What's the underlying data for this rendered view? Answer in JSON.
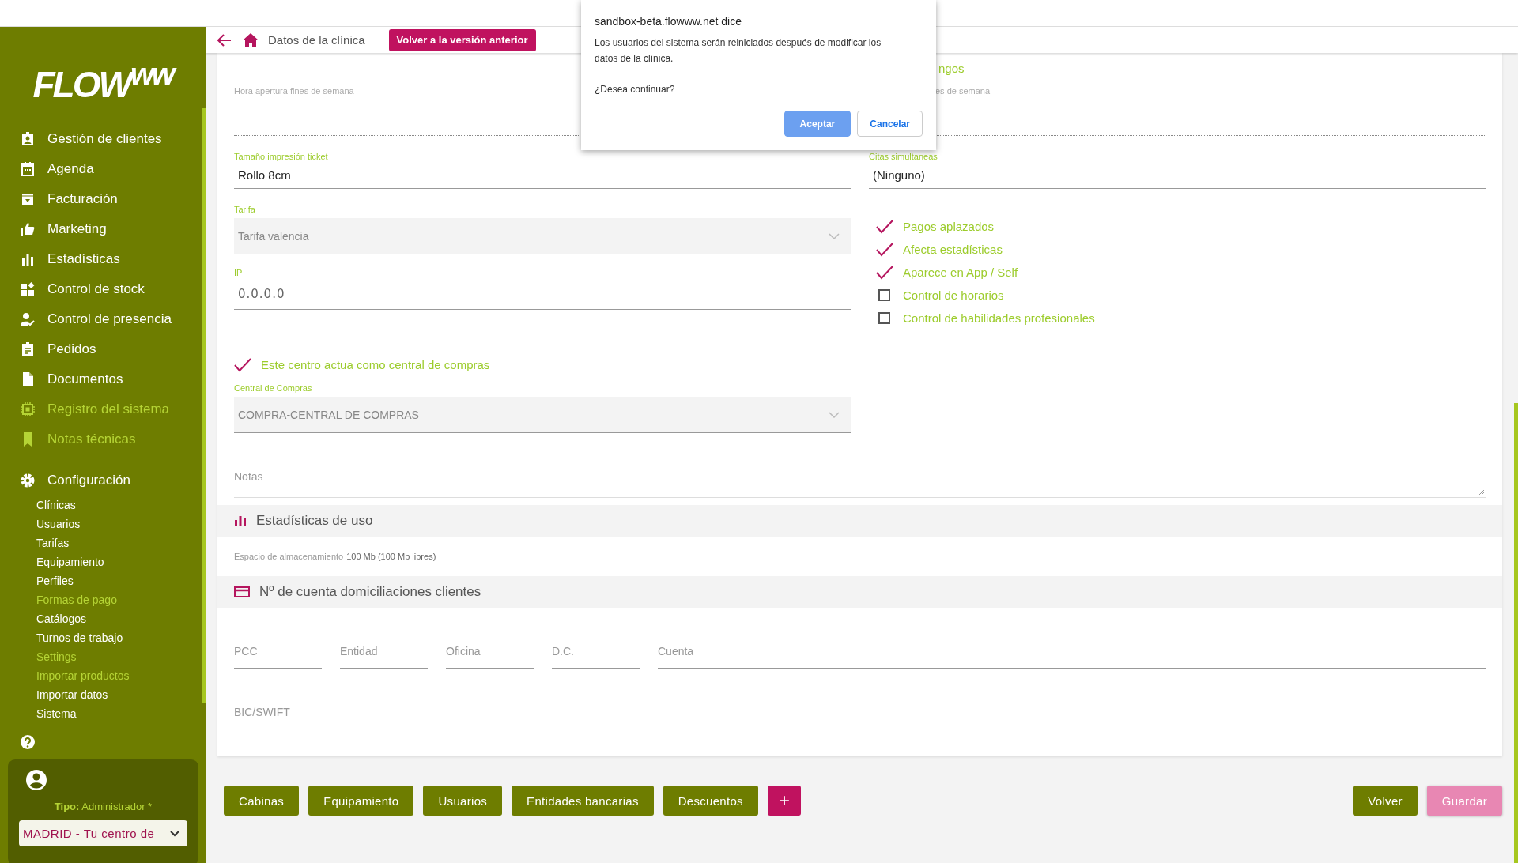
{
  "sidebar": {
    "logo": "FLOW$^{ww}$",
    "nav": [
      {
        "label": "Gestión de clientes",
        "highlighted": false
      },
      {
        "label": "Agenda",
        "highlighted": false
      },
      {
        "label": "Facturación",
        "highlighted": false
      },
      {
        "label": "Marketing",
        "highlighted": false
      },
      {
        "label": "Estadísticas",
        "highlighted": false
      },
      {
        "label": "Control de stock",
        "highlighted": false
      },
      {
        "label": "Control de presencia",
        "highlighted": false
      },
      {
        "label": "Pedidos",
        "highlighted": false
      },
      {
        "label": "Documentos",
        "highlighted": false
      },
      {
        "label": "Registro del sistema",
        "highlighted": true
      },
      {
        "label": "Notas técnicas",
        "highlighted": true
      }
    ],
    "config": {
      "label": "Configuración",
      "items": [
        {
          "label": "Clínicas",
          "highlighted": false
        },
        {
          "label": "Usuarios",
          "highlighted": false
        },
        {
          "label": "Tarifas",
          "highlighted": false
        },
        {
          "label": "Equipamiento",
          "highlighted": false
        },
        {
          "label": "Perfiles",
          "highlighted": false
        },
        {
          "label": "Formas de pago",
          "highlighted": true
        },
        {
          "label": "Catálogos",
          "highlighted": false
        },
        {
          "label": "Turnos de trabajo",
          "highlighted": false
        },
        {
          "label": "Settings",
          "highlighted": true
        },
        {
          "label": "Importar productos",
          "highlighted": true
        },
        {
          "label": "Importar datos",
          "highlighted": false
        },
        {
          "label": "Sistema",
          "highlighted": false
        }
      ]
    },
    "user": {
      "role": "**Tipo:** Administrador *",
      "center": "MADRID - Tu centro de"
    }
  },
  "header": {
    "title": "Datos de la clínica",
    "legacy_button": "Volver a la versión anterior"
  },
  "form": {
    "top_right_option": "ngos",
    "row1": [
      {
        "label": "Hora apertura fines de semana",
        "kind": "dotted"
      },
      {
        "label": "es de semana",
        "kind": "dotted-select"
      }
    ],
    "row2": [
      {
        "label": "Tamaño impresión ticket",
        "value": "Rollo 8cm",
        "kind": "text"
      },
      {
        "label": "Citas simultaneas",
        "value": "(Ninguno)",
        "kind": "text"
      }
    ],
    "left": [
      {
        "label": "Tarifa",
        "value": "Tarifa valencia",
        "kind": "filled-select"
      },
      {
        "label": "IP",
        "value": "0.0.0.0",
        "kind": "text"
      }
    ],
    "options": [
      {
        "label": "Pagos aplazados",
        "checked": true
      },
      {
        "label": "Afecta estadísticas",
        "checked": true
      },
      {
        "label": "Aparece en App / Self",
        "checked": true
      },
      {
        "label": "Control de horarios",
        "checked": false
      },
      {
        "label": "Control de habilidades profesionales",
        "checked": false
      }
    ],
    "central_option": {
      "label": "Este centro actua como central de compras",
      "checked": true
    },
    "central_field": {
      "label": "Central de Compras",
      "value": "COMPRA-CENTRAL DE COMPRAS",
      "kind": "filled-select"
    },
    "notes": {
      "placeholder": "Notas"
    }
  },
  "usage": {
    "title": "Estadísticas de uso",
    "storage_label": "Espacio de almacenamiento",
    "storage_value": "100 Mb (100 Mb libres)"
  },
  "bank": {
    "title": "Nº de cuenta domiciliaciones clientes",
    "fields": [
      {
        "placeholder": "PCC"
      },
      {
        "placeholder": "Entidad"
      },
      {
        "placeholder": "Oficina"
      },
      {
        "placeholder": "D.C."
      },
      {
        "placeholder": "Cuenta"
      }
    ],
    "bic": {
      "placeholder": "BIC/SWIFT"
    }
  },
  "buttons": [
    {
      "label": "Cabinas",
      "kind": "link"
    },
    {
      "label": "Equipamiento",
      "kind": "link"
    },
    {
      "label": "Usuarios",
      "kind": "link"
    },
    {
      "label": "Entidades bancarias",
      "kind": "link"
    },
    {
      "label": "Descuentos",
      "kind": "link"
    },
    {
      "label": "+",
      "kind": "add"
    }
  ],
  "actions": [
    {
      "label": "Volver",
      "kind": "back"
    },
    {
      "label": "Guardar",
      "kind": "save"
    }
  ],
  "dialog": {
    "title": "sandbox-beta.flowww.net dice",
    "message": "Los usuarios del sistema serán reiniciados después de modificar los datos de la clínica.",
    "question": "¿Desea continuar?",
    "buttons": [
      {
        "label": "Aceptar",
        "kind": "primary"
      },
      {
        "label": "Cancelar",
        "kind": "default"
      }
    ]
  }
}
